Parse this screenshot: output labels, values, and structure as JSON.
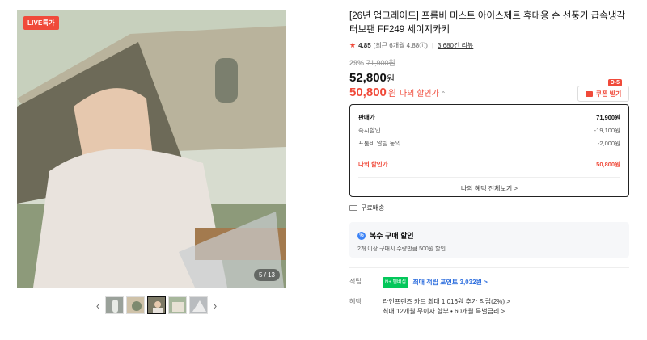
{
  "gallery": {
    "live_badge": "LIVE특가",
    "slide_counter": "5 / 13",
    "prev_arrow": "‹",
    "next_arrow": "›",
    "thumbnail_count": 5
  },
  "product": {
    "title": "[26년 업그레이드] 프롬비 미스트 아이스제트 휴대용 손 선풍기 급속냉각 터보팬 FF249 세이지카키",
    "rating": "4.85",
    "rating_sub": "(최근 6개월 4.88ⓘ)",
    "review_count": "3,680건 리뷰",
    "discount_rate": "29%",
    "original_price": "71,900원",
    "sale_price": "52,800",
    "my_price": "50,800",
    "won": "원",
    "my_price_label": "나의 할인가",
    "my_price_chevron": "⌃"
  },
  "coupon": {
    "dday": "D-5",
    "label": "쿠폰 받기"
  },
  "price_box": {
    "rows": [
      {
        "label": "판매가",
        "value": "71,900원"
      },
      {
        "label": "즉시할인",
        "value": "-19,100원"
      },
      {
        "label": "프롬비 알림 동의",
        "value": "-2,000원"
      }
    ],
    "my_label": "나의 할인가",
    "my_value": "50,800원",
    "benefit_link": "나의 혜택 전체보기 >"
  },
  "shipping": {
    "free": "무료배송"
  },
  "multi_buy": {
    "title": "복수 구매 할인",
    "desc": "2개 이상 구매시 수량만큼 500원 할인"
  },
  "points": {
    "key": "적립",
    "badge": "N+ 멤버십",
    "text": "최대 적립 포인트 3,032원 >"
  },
  "benefits": {
    "key": "혜택",
    "line1": "라인프렌즈 카드 최대 1,016원 추가 적립(2%) >",
    "line2": "최대 12개월 무이자 할부 • 60개월 특별금리 >"
  },
  "colors": {
    "accent": "#f04a3a",
    "link_blue": "#2f6fde"
  }
}
